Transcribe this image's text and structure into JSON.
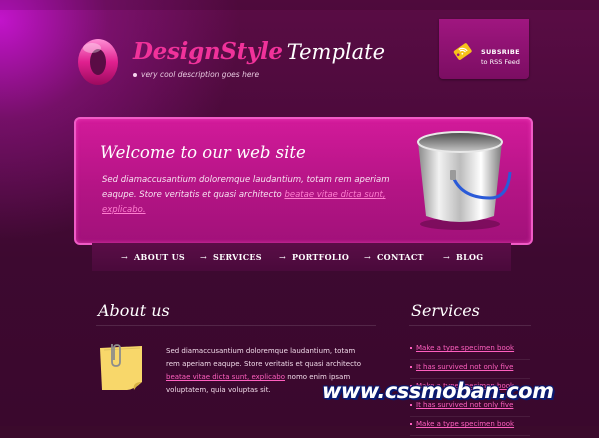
{
  "header": {
    "logo_letter": "O",
    "title_colored": "DesignStyle",
    "title_white": "Template",
    "tagline": "very cool description goes here"
  },
  "rss": {
    "line1": "SUBSRIBE",
    "line2": "to RSS Feed",
    "icon": "rss-tag-icon"
  },
  "welcome": {
    "heading": "Welcome to our web site",
    "text": "Sed diamaccusantium doloremque laudantium, totam rem aperiam eaqupe. Store veritatis et quasi architecto ",
    "link": "beatae vitae dicta sunt, explicabo."
  },
  "nav": {
    "items": [
      {
        "label": "ABOUT US"
      },
      {
        "label": "SERVICES"
      },
      {
        "label": "PORTFOLIO"
      },
      {
        "label": "CONTACT"
      },
      {
        "label": "BLOG"
      }
    ]
  },
  "about": {
    "heading": "About us",
    "text1": "Sed diamaccusantium doloremque laudantium, totam rem aperiam eaqupe. Store veritatis et quasi architecto ",
    "link": "beatae vitae dicta sunt, explicabo",
    "text2": " nomo enim ipsam voluptatem, quia voluptas sit."
  },
  "services": {
    "heading": "Services",
    "items": [
      "Make a type specimen book",
      "It has survived not only five",
      "Make a type specimen book",
      "It has survived not only five",
      "Make a type specimen book"
    ]
  },
  "watermark": "www.cssmoban.com",
  "colors": {
    "accent_pink": "#f0329a",
    "panel_magenta": "#b41485",
    "background": "#3b0a2c"
  }
}
